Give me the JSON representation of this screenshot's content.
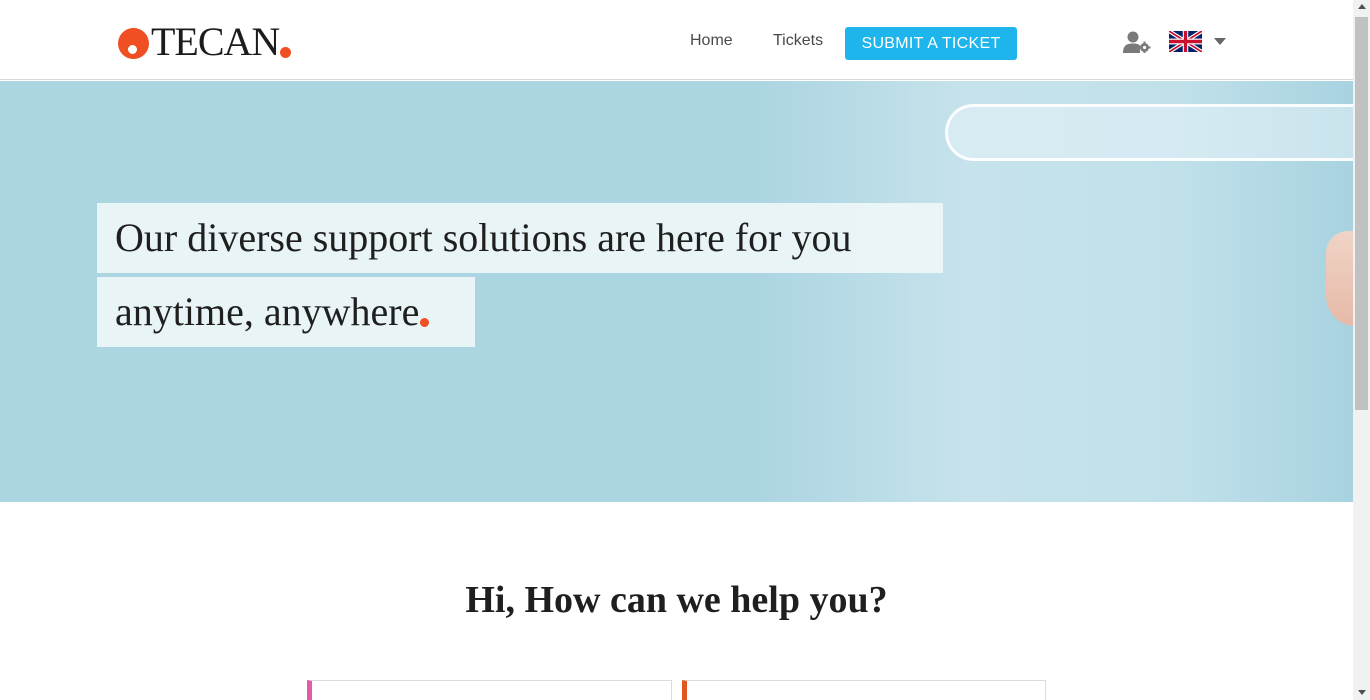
{
  "header": {
    "logo_text": "TECAN",
    "nav": {
      "home": "Home",
      "tickets": "Tickets",
      "submit": "SUBMIT A TICKET"
    },
    "icons": {
      "user_settings": "user-settings-icon",
      "language_flag": "uk-flag-icon",
      "dropdown": "caret-down-icon"
    }
  },
  "hero": {
    "line1": "Our diverse support solutions are here for you",
    "line2": "anytime, anywhere"
  },
  "help": {
    "title": "Hi, How can we help you?"
  },
  "colors": {
    "brand_orange": "#f04e23",
    "button_blue": "#1eb4ec",
    "hero_bg": "#acd5e2",
    "card_pink": "#e25aa8",
    "card_orange": "#e2571f"
  }
}
